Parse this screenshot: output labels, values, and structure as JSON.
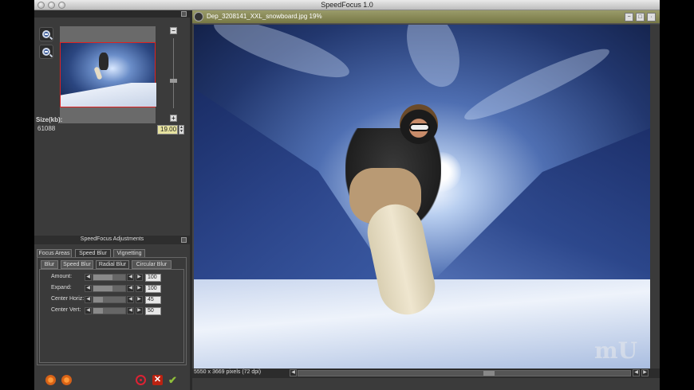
{
  "app": {
    "title": "SpeedFocus 1.0"
  },
  "navigator": {
    "size_label": "Size(kb):",
    "size_value": "61088",
    "zoom_value": "19.00",
    "zoom_in_icon": "zoom-in-icon",
    "zoom_out_icon": "zoom-out-icon",
    "plus_label": "+",
    "minus_label": "−"
  },
  "adjustments": {
    "header": "SpeedFocus Adjustments",
    "tabs": [
      {
        "label": "Focus Areas"
      },
      {
        "label": "Speed Blur"
      },
      {
        "label": "Vignetting"
      }
    ],
    "active_tab": "Speed Blur",
    "subtabs": [
      {
        "label": "Blur"
      },
      {
        "label": "Speed Blur"
      },
      {
        "label": "Radial Blur"
      },
      {
        "label": "Circular Blur"
      }
    ],
    "active_subtab": "Radial Blur",
    "rows": [
      {
        "label": "Amount:",
        "value": "100"
      },
      {
        "label": "Expand:",
        "value": "100"
      },
      {
        "label": "Center Horiz:",
        "value": "45"
      },
      {
        "label": "Center Vert:",
        "value": "50"
      }
    ]
  },
  "document": {
    "title": "Dep_3208141_XXL_snowboard.jpg 19%",
    "status": "5550 x 3669 pixels (72 dpi)",
    "watermark": "mU"
  },
  "colors": {
    "accent_olive": "#8a8b55",
    "zoom_field": "#e7e3a0",
    "cancel_red": "#bb2211",
    "ok_green": "#8fbf3a"
  }
}
